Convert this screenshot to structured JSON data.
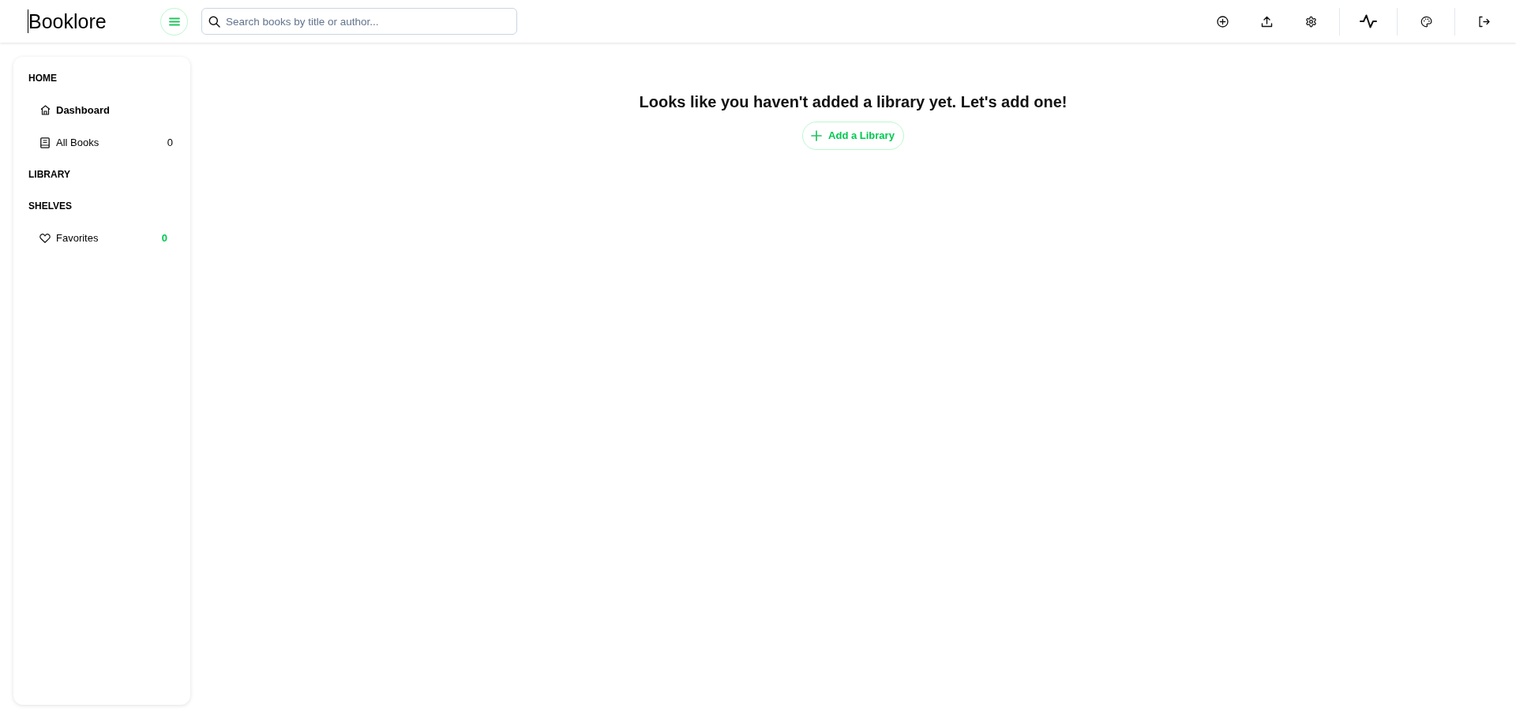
{
  "header": {
    "logo": "Booklore",
    "search": {
      "placeholder": "Search books by title or author..."
    }
  },
  "sidebar": {
    "sections": [
      {
        "title": "HOME",
        "items": [
          {
            "kind": "home",
            "label": "Dashboard",
            "selected": true
          },
          {
            "kind": "books",
            "label": "All Books",
            "count": "0",
            "selected": false
          }
        ]
      },
      {
        "title": "LIBRARY"
      },
      {
        "title": "SHELVES",
        "items": [
          {
            "kind": "shelf",
            "label": "Favorites",
            "count": "0",
            "selected": false
          }
        ]
      }
    ]
  },
  "main": {
    "message": "Looks like you haven't added a library yet. Let's add one!",
    "add_button": {
      "label": "Add a Library"
    }
  }
}
